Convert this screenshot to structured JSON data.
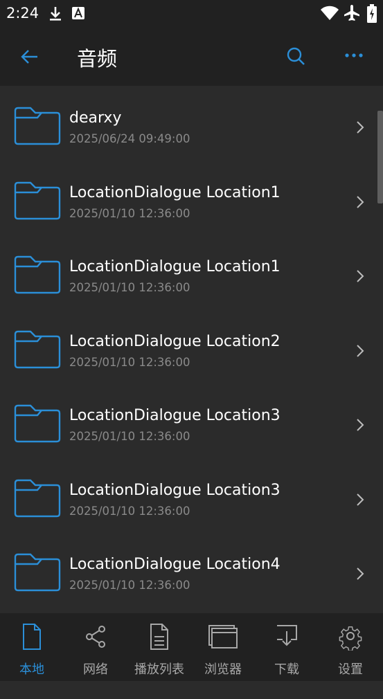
{
  "status_bar": {
    "time": "2:24",
    "icons": [
      "download-icon",
      "a-badge-icon",
      "wifi-icon",
      "airplane-icon",
      "battery-icon"
    ]
  },
  "app_bar": {
    "title": "音频",
    "icons": [
      "back-arrow-icon",
      "search-icon",
      "more-icon"
    ]
  },
  "list": {
    "items": [
      {
        "name": "dearxy",
        "date": "2025/06/24 09:49:00"
      },
      {
        "name": "LocationDialogue Location1",
        "date": "2025/01/10 12:36:00"
      },
      {
        "name": "LocationDialogue Location1",
        "date": "2025/01/10 12:36:00"
      },
      {
        "name": "LocationDialogue Location2",
        "date": "2025/01/10 12:36:00"
      },
      {
        "name": "LocationDialogue Location3",
        "date": "2025/01/10 12:36:00"
      },
      {
        "name": "LocationDialogue Location3",
        "date": "2025/01/10 12:36:00"
      },
      {
        "name": "LocationDialogue Location4",
        "date": "2025/01/10 12:36:00"
      }
    ]
  },
  "bottom_nav": {
    "items": [
      {
        "label": "本地",
        "icon": "document-icon",
        "active": true
      },
      {
        "label": "网络",
        "icon": "share-icon",
        "active": false
      },
      {
        "label": "播放列表",
        "icon": "playlist-icon",
        "active": false
      },
      {
        "label": "浏览器",
        "icon": "browser-icon",
        "active": false
      },
      {
        "label": "下载",
        "icon": "download-tray-icon",
        "active": false
      },
      {
        "label": "设置",
        "icon": "gear-icon",
        "active": false
      }
    ]
  },
  "colors": {
    "accent": "#2b8fd8",
    "background": "#2b2b2b",
    "bar": "#212121",
    "secondary_text": "#8a8a8a"
  }
}
